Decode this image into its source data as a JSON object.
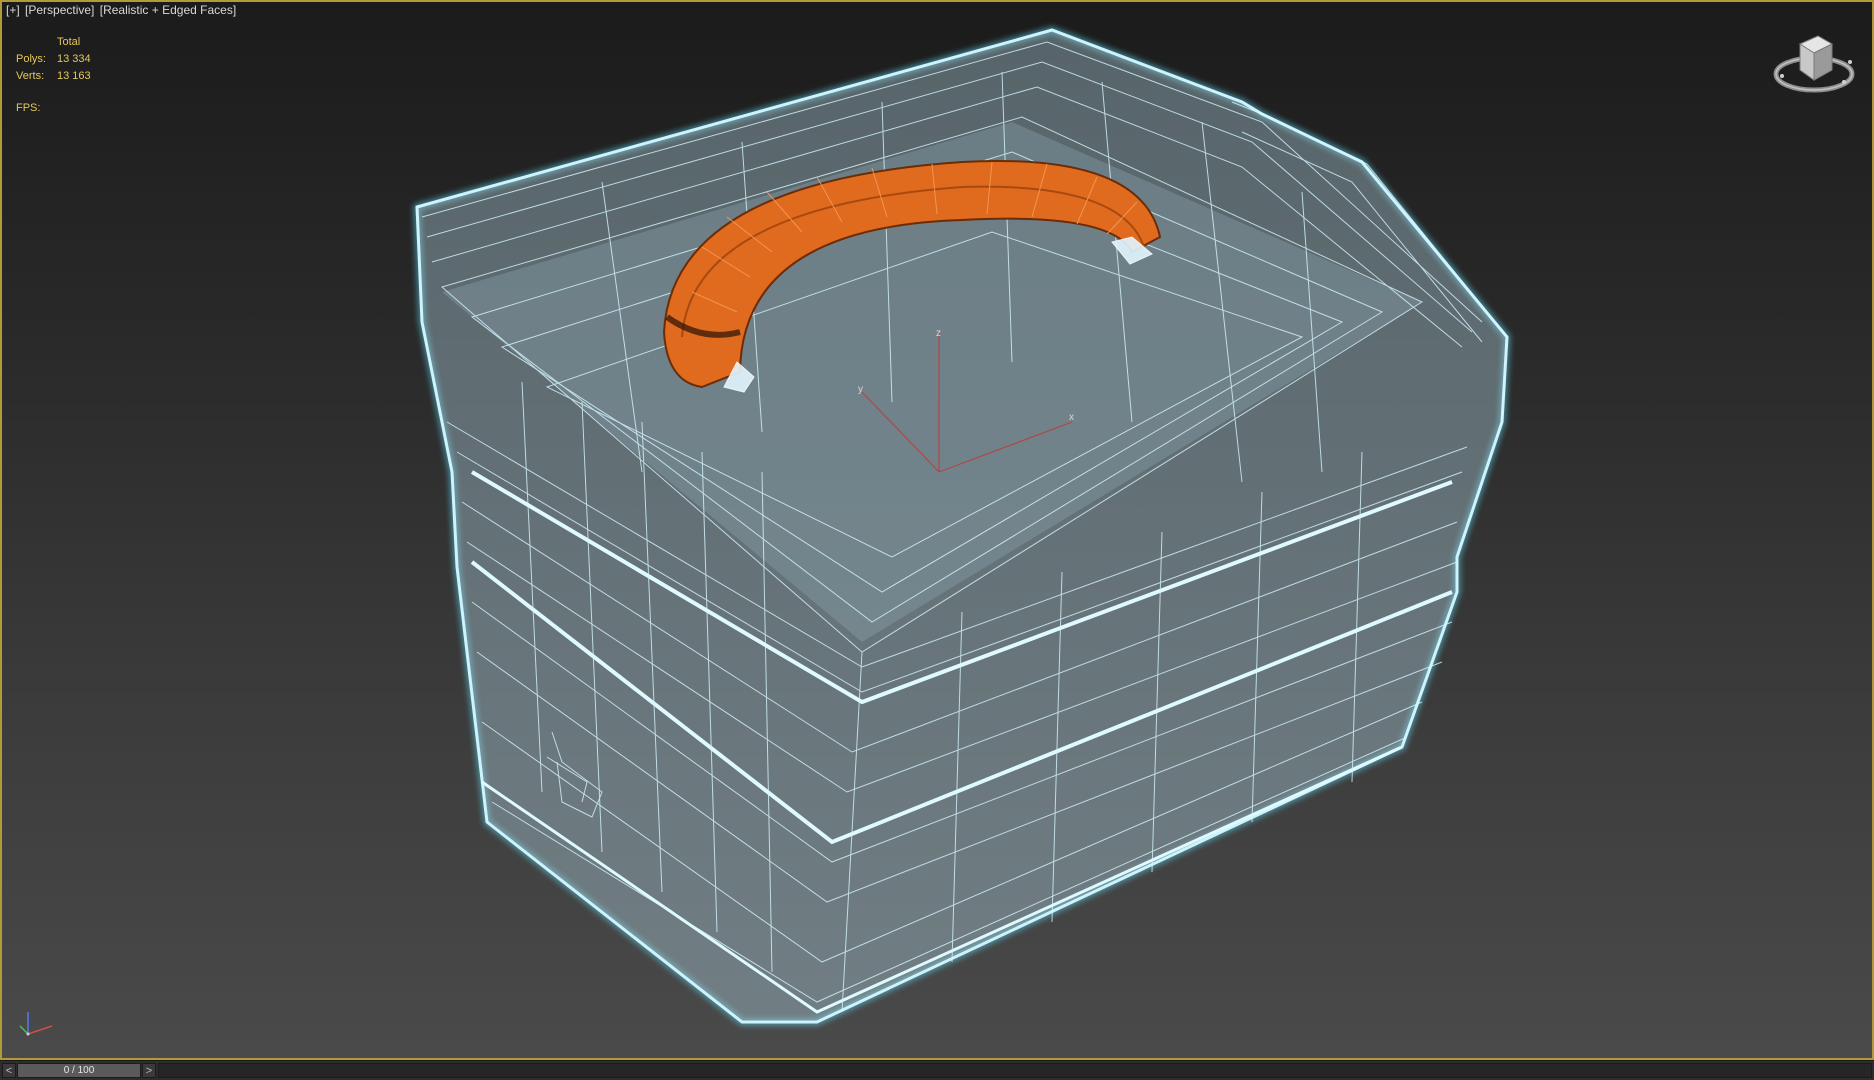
{
  "viewport": {
    "label": {
      "plus": "[+]",
      "view": "[Perspective]",
      "mode": "[Realistic + Edged Faces]"
    },
    "stats": {
      "header": "Total",
      "polys_label": "Polys:",
      "polys_value": "13 334",
      "verts_label": "Verts:",
      "verts_value": "13 163",
      "fps_label": "FPS:"
    },
    "gizmo": {
      "x": "x",
      "y": "y",
      "z": "z"
    },
    "colors": {
      "wire": "#c9f0fb",
      "outline": "#5fd4ee",
      "handle": "#e06a1e",
      "frame": "#b29a3c"
    }
  },
  "timeline": {
    "prev": "<",
    "next": ">",
    "frame": "0 / 100"
  }
}
